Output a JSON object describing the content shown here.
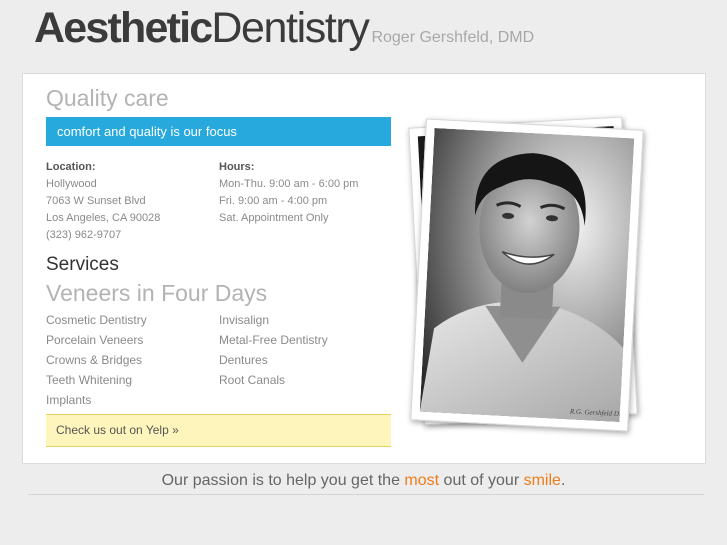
{
  "header": {
    "logo_bold": "Aesthetic",
    "logo_light": "Dentistry",
    "doctor_name": "Roger Gershfeld, DMD"
  },
  "intro": {
    "title": "Quality care",
    "tagline": "comfort and quality is our focus"
  },
  "location": {
    "heading": "Location:",
    "lines": [
      "Hollywood",
      "7063 W Sunset Blvd",
      "Los Angeles, CA 90028",
      "(323) 962-9707"
    ]
  },
  "hours": {
    "heading": "Hours:",
    "lines": [
      "Mon-Thu. 9:00 am - 6:00 pm",
      "Fri. 9:00 am - 4:00 pm",
      "Sat. Appointment Only"
    ]
  },
  "services": {
    "title": "Services",
    "subtitle": "Veneers in Four Days",
    "col1": [
      "Cosmetic Dentistry",
      "Porcelain Veneers",
      "Crowns & Bridges",
      "Teeth Whitening",
      "Implants"
    ],
    "col2": [
      "Invisalign",
      "Metal-Free Dentistry",
      "Dentures",
      "Root Canals"
    ]
  },
  "yelp": {
    "label": "Check us out on Yelp »"
  },
  "photo": {
    "signature": "R.G. Gershfeld D.D.S."
  },
  "footer": {
    "part1": "Our passion is to help you get the ",
    "highlight1": "most",
    "part2": " out of your ",
    "highlight2": "smile",
    "part3": "."
  },
  "colors": {
    "accent_blue": "#27a9dd",
    "accent_orange": "#ee7d1c",
    "yelp_bg": "#fdf5bb"
  }
}
